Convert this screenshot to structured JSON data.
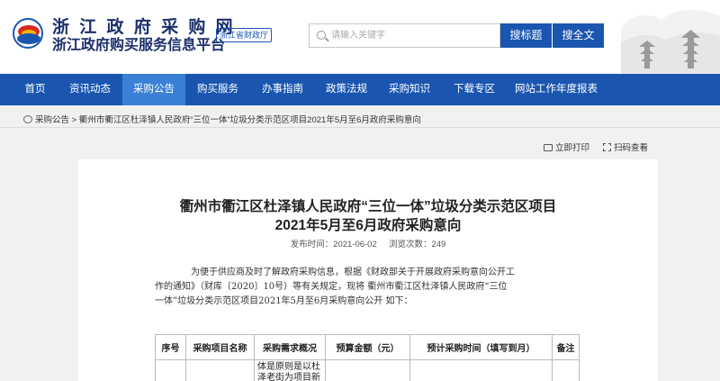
{
  "header": {
    "brand_line1": "浙 江 政 府 采 购 网",
    "brand_line2": "浙江政府购买服务信息平台",
    "dept_badge": "浙江省财政厅",
    "search_placeholder": "请输入关键字",
    "search_title_btn": "搜标题",
    "search_full_btn": "搜全文"
  },
  "nav": {
    "items": [
      "首页",
      "资讯动态",
      "采购公告",
      "购买服务",
      "办事指南",
      "政策法规",
      "采购知识",
      "下载专区",
      "网站工作年度报表"
    ],
    "active_index": 2
  },
  "breadcrumb": {
    "section": "采购公告",
    "separator": ">",
    "current": "衢州市衢江区杜泽镇人民政府“三位一体”垃圾分类示范区项目2021年5月至6月政府采购意向"
  },
  "tools": {
    "print": "立即打印",
    "scan": "扫码查看"
  },
  "article": {
    "title_line1": "衢州市衢江区杜泽镇人民政府“三位一体”垃圾分类示范区项目",
    "title_line2": "2021年5月至6月政府采购意向",
    "publish_label": "发布时间：",
    "publish_time": "2021-06-02",
    "views_label": "浏览次数：",
    "views": "249",
    "para_line1": "为便于供应商及时了解政府采购信息，根据《财政部关于开展政府采购意向公开工",
    "para_line2": "作的通知》（财库〔2020〕10号）等有关规定，现将 衢州市衢江区杜泽镇人民政府“三位",
    "para_line3": "一体”垃圾分类示范区项目2021年5月至6月采购意向公开 如下："
  },
  "table": {
    "headers": [
      "序号",
      "采购项目名称",
      "采购需求概况",
      "预算金额（元）",
      "预计采购时间（填写到月）",
      "备注"
    ],
    "row1_demand_line1": "体是原则是以杜",
    "row1_demand_line2": "泽老街为项目新"
  },
  "colors": {
    "primary": "#1a56b0",
    "nav_active": "#3a80d6",
    "page_bg": "#f1f1f1",
    "brand_text": "#1b2f6b"
  }
}
